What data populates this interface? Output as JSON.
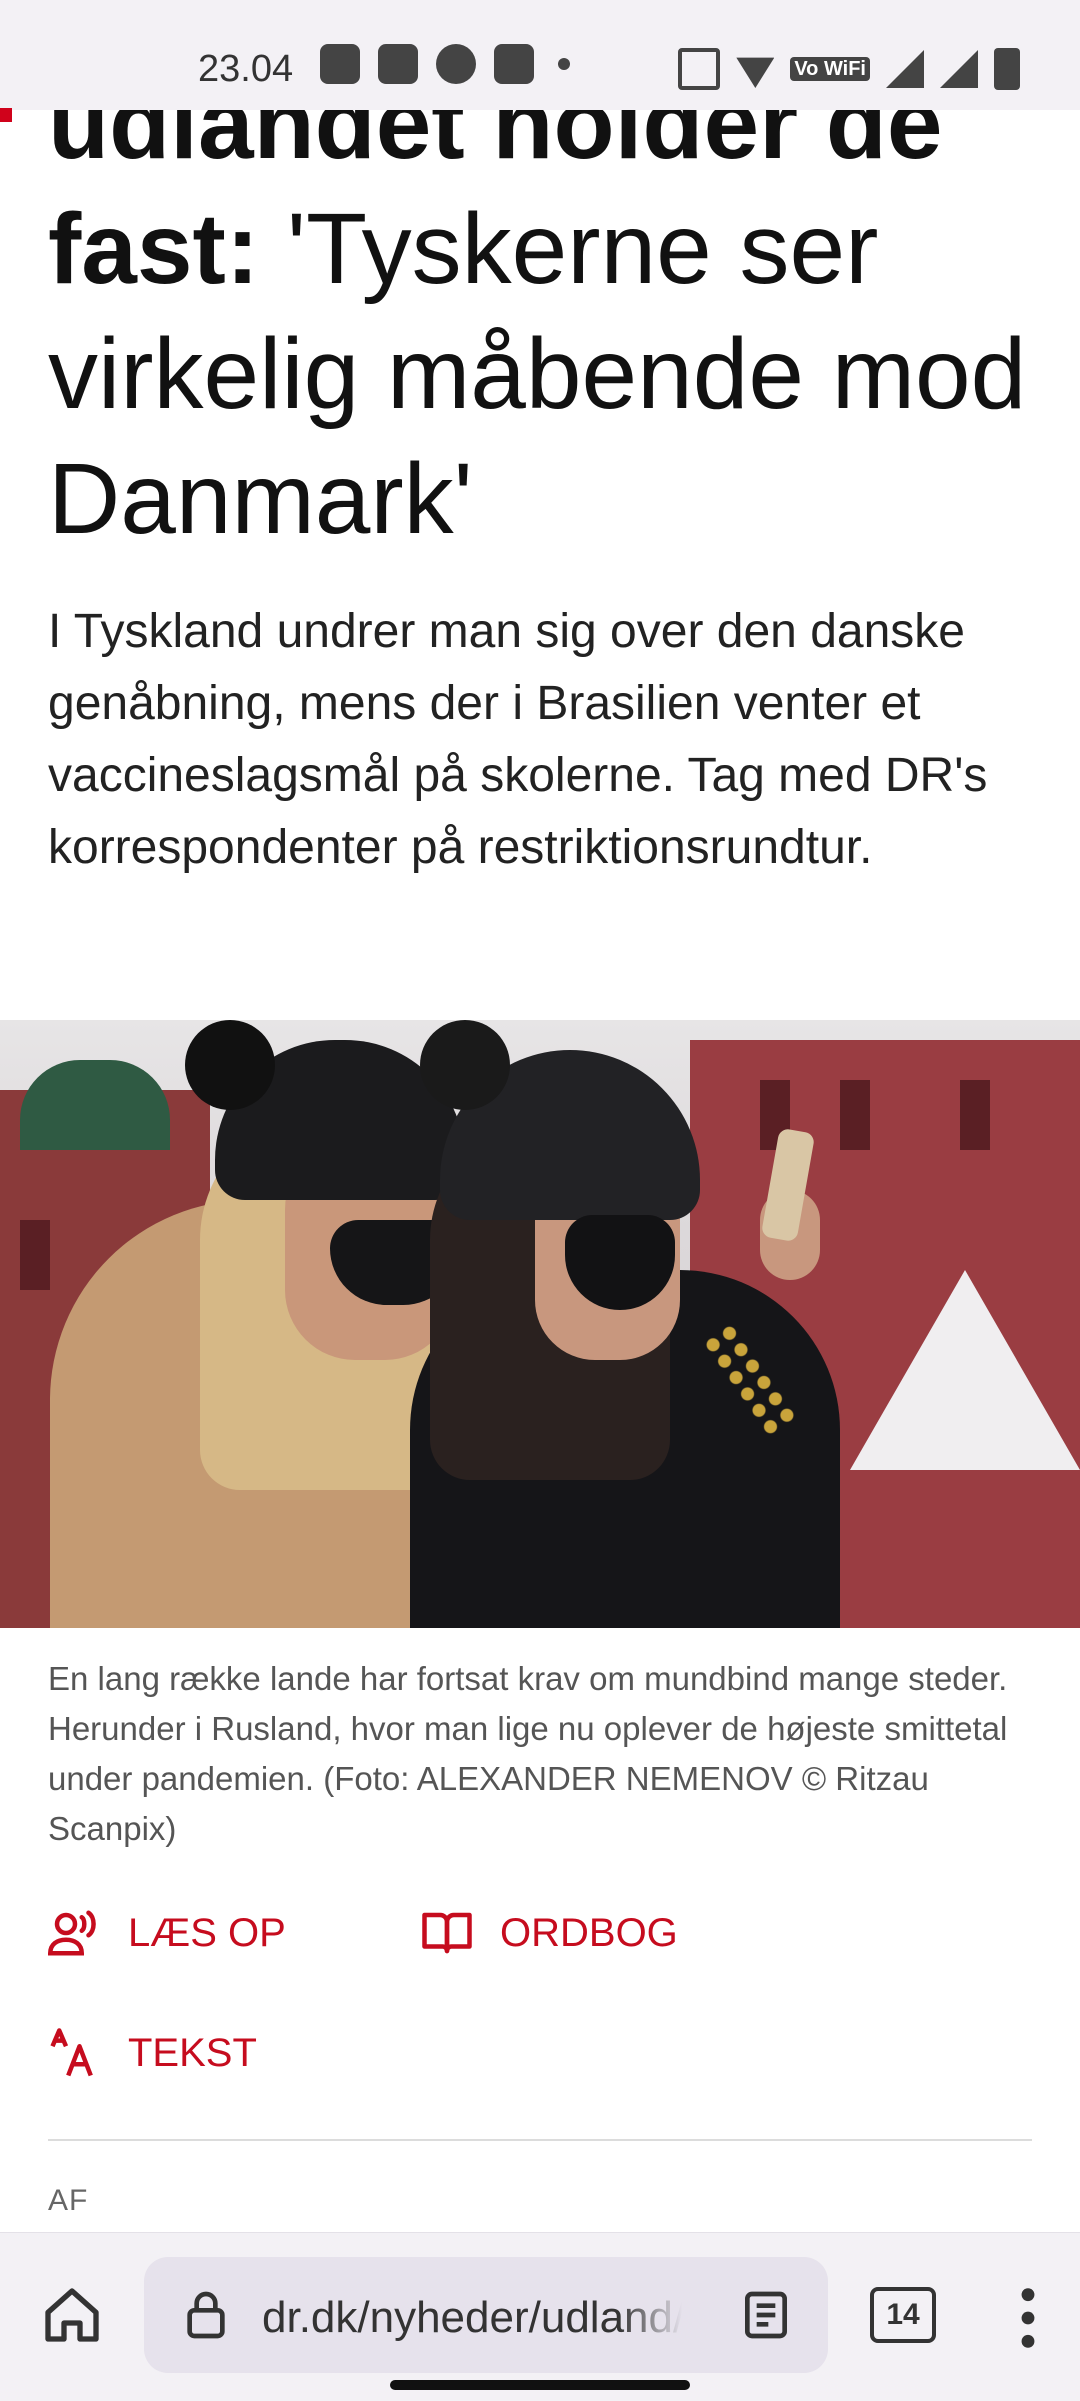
{
  "status_bar": {
    "time": "23.04",
    "vowifi": "Vo WiFi"
  },
  "article": {
    "headline_bold": "udlandet holder de fast:",
    "headline_rest": " 'Tyskerne ser virkelig måbende mod Danmark'",
    "lead": "I Tyskland undrer man sig over den danske genåbning, mens der i Brasilien venter et vaccineslagsmål på skolerne. Tag med DR's korrespondenter på restriktionsrundtur.",
    "caption": "En lang række lande har fortsat krav om mundbind mange steder. Herunder i Rusland, hvor man lige nu oplever de højeste smittetal under pandemien. (Foto: ALEXANDER NEMENOV © Ritzau Scanpix)",
    "author_label": "AF"
  },
  "tools": {
    "read_aloud": "LÆS OP",
    "dictionary": "ORDBOG",
    "text": "TEKST"
  },
  "browser": {
    "url": "dr.dk/nyheder/udland/",
    "tab_count": "14"
  },
  "colors": {
    "accent": "#c60c1e",
    "browser_bar": "#f3f1f5"
  }
}
